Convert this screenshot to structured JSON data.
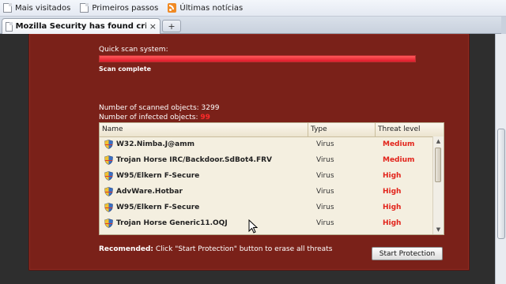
{
  "bookmarks": [
    {
      "label": "Mais visitados",
      "icon": "page-icon"
    },
    {
      "label": "Primeiros passos",
      "icon": "page-icon"
    },
    {
      "label": "Últimas notícias",
      "icon": "rss-icon"
    }
  ],
  "tab": {
    "title": "Mozilla Security has found critical pro...",
    "close": "×",
    "new_tab": "+"
  },
  "scan": {
    "label": "Quick scan system:",
    "progress": 1.0,
    "complete_text": "Scan complete"
  },
  "summary": {
    "scanned_label": "Number of scanned objects: 3299",
    "infected_label": "Number of infected objects:",
    "infected_value": "99"
  },
  "table": {
    "columns": [
      "Name",
      "Type",
      "Threat level"
    ],
    "rows": [
      {
        "name": "W32.Nimba.J@amm",
        "type": "Virus",
        "level": "Medium"
      },
      {
        "name": "Trojan Horse IRC/Backdoor.SdBot4.FRV",
        "type": "Virus",
        "level": "Medium"
      },
      {
        "name": "W95/Elkern F-Secure",
        "type": "Virus",
        "level": "High"
      },
      {
        "name": "AdvWare.Hotbar",
        "type": "Virus",
        "level": "High"
      },
      {
        "name": "W95/Elkern F-Secure",
        "type": "Virus",
        "level": "High"
      },
      {
        "name": "Trojan Horse Generic11.OQJ",
        "type": "Virus",
        "level": "High"
      }
    ]
  },
  "recommend": {
    "prefix": "Recomended:",
    "text": " Click \"Start Protection\" button to erase all threats"
  },
  "start_button": "Start Protection",
  "colors": {
    "panel": "#7a2119",
    "threat": "#e2231a",
    "progress": "#e0182a"
  }
}
